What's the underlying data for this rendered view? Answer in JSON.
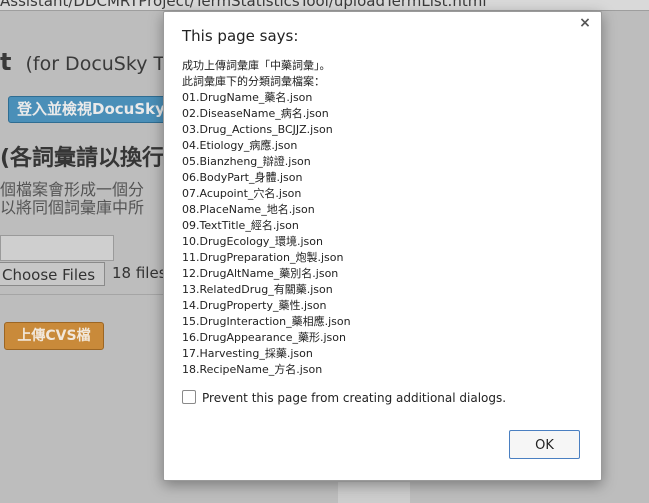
{
  "background": {
    "url_fragment": "Assistant/DDCMRTProject/TermStatisticsTool/uploadTermList.html",
    "title_letter": "t",
    "title_suffix": "(for DocuSky T",
    "login_button": "登入並檢視DocuSky",
    "heading": "(各詞彙請以換行",
    "desc_line1": "個檔案會形成一個分",
    "desc_line2": "以將同個詞彙庫中所",
    "choose_files": "Choose Files",
    "files_status": "18 files",
    "upload_button": "上傳CVS檔"
  },
  "dialog": {
    "title": "This page says:",
    "close_glyph": "×",
    "message_lines": [
      "成功上傳詞彙庫「中藥詞彙」。",
      "此詞彙庫下的分類詞彙檔案：",
      "01.DrugName_藥名.json",
      "02.DiseaseName_病名.json",
      "03.Drug_Actions_BCJJZ.json",
      "04.Etiology_病應.json",
      "05.Bianzheng_辯證.json",
      "06.BodyPart_身體.json",
      "07.Acupoint_穴名.json",
      "08.PlaceName_地名.json",
      "09.TextTitle_經名.json",
      "10.DrugEcology_環境.json",
      "11.DrugPreparation_炮製.json",
      "12.DrugAltName_藥別名.json",
      "13.RelatedDrug_有關藥.json",
      "14.DrugProperty_藥性.json",
      "15.DrugInteraction_藥相應.json",
      "16.DrugAppearance_藥形.json",
      "17.Harvesting_採藥.json",
      "18.RecipeName_方名.json"
    ],
    "prevent_label": "Prevent this page from creating additional dialogs.",
    "prevent_checked": false,
    "ok_label": "OK"
  }
}
